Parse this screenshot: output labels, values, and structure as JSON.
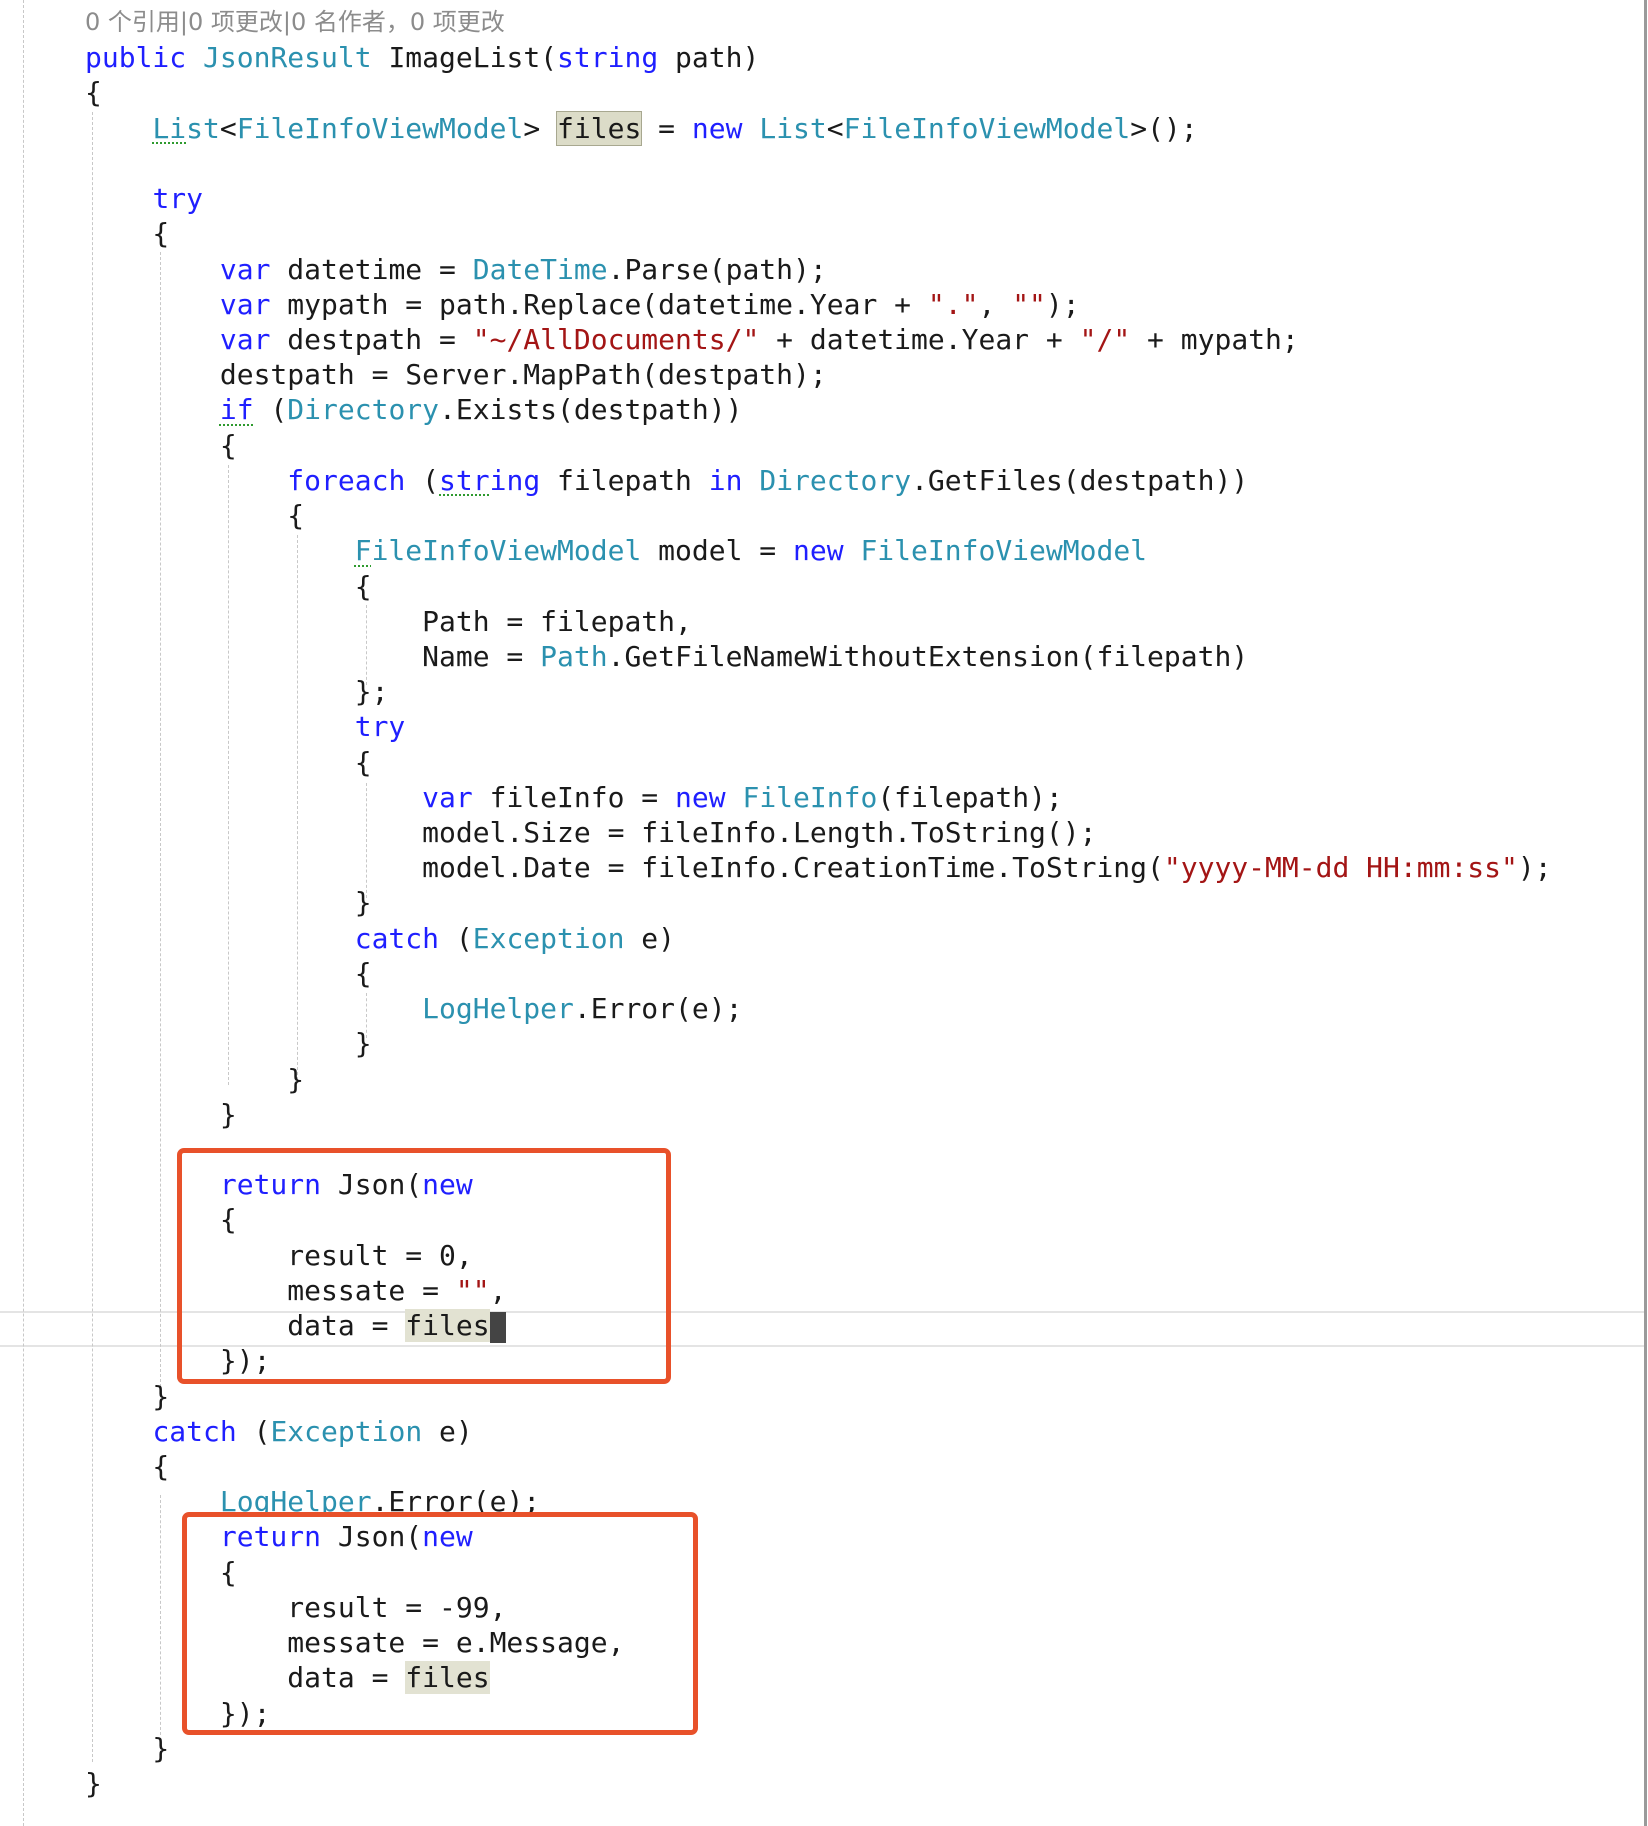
{
  "code_lens": "0 个引用|0 项更改|0 名作者，0 项更改",
  "colors": {
    "keyword": "#1f1fff",
    "type": "#2b91af",
    "string": "#a31515",
    "highlight_box": "#e8512a"
  },
  "lines": [
    [],
    [
      {
        "t": "public ",
        "c": "kw"
      },
      {
        "t": "JsonResult ",
        "c": "ty"
      },
      {
        "t": "ImageList(",
        "c": "pl"
      },
      {
        "t": "string",
        "c": "kw"
      },
      {
        "t": " path)",
        "c": "pl"
      }
    ],
    [
      {
        "t": "{",
        "c": "pl"
      }
    ],
    [
      {
        "t": "    ",
        "c": "pl"
      },
      {
        "t": "Li",
        "c": "ty sq"
      },
      {
        "t": "st",
        "c": "ty"
      },
      {
        "t": "<",
        "c": "pl"
      },
      {
        "t": "FileInfoViewModel",
        "c": "ty"
      },
      {
        "t": "> ",
        "c": "pl"
      },
      {
        "t": "files",
        "c": "pl hl"
      },
      {
        "t": " = ",
        "c": "pl"
      },
      {
        "t": "new ",
        "c": "kw"
      },
      {
        "t": "List",
        "c": "ty"
      },
      {
        "t": "<",
        "c": "pl"
      },
      {
        "t": "FileInfoViewModel",
        "c": "ty"
      },
      {
        "t": ">();",
        "c": "pl"
      }
    ],
    [],
    [
      {
        "t": "    ",
        "c": "pl"
      },
      {
        "t": "try",
        "c": "kw"
      }
    ],
    [
      {
        "t": "    {",
        "c": "pl"
      }
    ],
    [
      {
        "t": "        ",
        "c": "pl"
      },
      {
        "t": "var ",
        "c": "kw"
      },
      {
        "t": "datetime = ",
        "c": "pl"
      },
      {
        "t": "DateTime",
        "c": "ty"
      },
      {
        "t": ".Parse(path);",
        "c": "pl"
      }
    ],
    [
      {
        "t": "        ",
        "c": "pl"
      },
      {
        "t": "var ",
        "c": "kw"
      },
      {
        "t": "mypath = path.Replace(datetime.Year + ",
        "c": "pl"
      },
      {
        "t": "\".\"",
        "c": "st"
      },
      {
        "t": ", ",
        "c": "pl"
      },
      {
        "t": "\"\"",
        "c": "st"
      },
      {
        "t": ");",
        "c": "pl"
      }
    ],
    [
      {
        "t": "        ",
        "c": "pl"
      },
      {
        "t": "var ",
        "c": "kw"
      },
      {
        "t": "destpath = ",
        "c": "pl"
      },
      {
        "t": "\"~/AllDocuments/\"",
        "c": "st"
      },
      {
        "t": " + datetime.Year + ",
        "c": "pl"
      },
      {
        "t": "\"/\"",
        "c": "st"
      },
      {
        "t": " + mypath;",
        "c": "pl"
      }
    ],
    [
      {
        "t": "        destpath = Server.MapPath(destpath);",
        "c": "pl"
      }
    ],
    [
      {
        "t": "        ",
        "c": "pl"
      },
      {
        "t": "if",
        "c": "kw sq"
      },
      {
        "t": " (",
        "c": "pl"
      },
      {
        "t": "Directory",
        "c": "ty"
      },
      {
        "t": ".Exists(destpath))",
        "c": "pl"
      }
    ],
    [
      {
        "t": "        {",
        "c": "pl"
      }
    ],
    [
      {
        "t": "            ",
        "c": "pl"
      },
      {
        "t": "foreach",
        "c": "kw"
      },
      {
        "t": " (",
        "c": "pl"
      },
      {
        "t": "str",
        "c": "kw sq"
      },
      {
        "t": "ing",
        "c": "kw"
      },
      {
        "t": " filepath ",
        "c": "pl"
      },
      {
        "t": "in ",
        "c": "kw"
      },
      {
        "t": "Directory",
        "c": "ty"
      },
      {
        "t": ".GetFiles(destpath))",
        "c": "pl"
      }
    ],
    [
      {
        "t": "            {",
        "c": "pl"
      }
    ],
    [
      {
        "t": "                ",
        "c": "pl"
      },
      {
        "t": "F",
        "c": "ty sq"
      },
      {
        "t": "ileInfoViewModel",
        "c": "ty"
      },
      {
        "t": " model = ",
        "c": "pl"
      },
      {
        "t": "new ",
        "c": "kw"
      },
      {
        "t": "FileInfoViewModel",
        "c": "ty"
      }
    ],
    [
      {
        "t": "                {",
        "c": "pl"
      }
    ],
    [
      {
        "t": "                    Path = filepath,",
        "c": "pl"
      }
    ],
    [
      {
        "t": "                    Name = ",
        "c": "pl"
      },
      {
        "t": "Path",
        "c": "ty"
      },
      {
        "t": ".GetFileNameWithoutExtension(filepath)",
        "c": "pl"
      }
    ],
    [
      {
        "t": "                };",
        "c": "pl"
      }
    ],
    [
      {
        "t": "                ",
        "c": "pl"
      },
      {
        "t": "try",
        "c": "kw"
      }
    ],
    [
      {
        "t": "                {",
        "c": "pl"
      }
    ],
    [
      {
        "t": "                    ",
        "c": "pl"
      },
      {
        "t": "var ",
        "c": "kw"
      },
      {
        "t": "fileInfo = ",
        "c": "pl"
      },
      {
        "t": "new ",
        "c": "kw"
      },
      {
        "t": "FileInfo",
        "c": "ty"
      },
      {
        "t": "(filepath);",
        "c": "pl"
      }
    ],
    [
      {
        "t": "                    model.Size = fileInfo.Length.ToString();",
        "c": "pl"
      }
    ],
    [
      {
        "t": "                    model.Date = fileInfo.CreationTime.ToString(",
        "c": "pl"
      },
      {
        "t": "\"yyyy-MM-dd HH:mm:ss\"",
        "c": "st"
      },
      {
        "t": ");",
        "c": "pl"
      }
    ],
    [
      {
        "t": "                }",
        "c": "pl"
      }
    ],
    [
      {
        "t": "                ",
        "c": "pl"
      },
      {
        "t": "catch",
        "c": "kw"
      },
      {
        "t": " (",
        "c": "pl"
      },
      {
        "t": "Exception",
        "c": "ty"
      },
      {
        "t": " e)",
        "c": "pl"
      }
    ],
    [
      {
        "t": "                {",
        "c": "pl"
      }
    ],
    [
      {
        "t": "                    ",
        "c": "pl"
      },
      {
        "t": "LogHelper",
        "c": "ty"
      },
      {
        "t": ".Error(e);",
        "c": "pl"
      }
    ],
    [
      {
        "t": "                }",
        "c": "pl"
      }
    ],
    [
      {
        "t": "            }",
        "c": "pl"
      }
    ],
    [
      {
        "t": "        }",
        "c": "pl"
      }
    ],
    [],
    [
      {
        "t": "        ",
        "c": "pl"
      },
      {
        "t": "return",
        "c": "kw"
      },
      {
        "t": " Json(",
        "c": "pl"
      },
      {
        "t": "new",
        "c": "kw"
      }
    ],
    [
      {
        "t": "        {",
        "c": "pl"
      }
    ],
    [
      {
        "t": "            result = 0,",
        "c": "pl"
      }
    ],
    [
      {
        "t": "            messate = ",
        "c": "pl"
      },
      {
        "t": "\"\"",
        "c": "st"
      },
      {
        "t": ",",
        "c": "pl"
      }
    ],
    [
      {
        "t": "            data = ",
        "c": "pl"
      },
      {
        "t": "files",
        "c": "pl hl2"
      },
      {
        "t": "",
        "c": "cursor"
      }
    ],
    [
      {
        "t": "        });",
        "c": "pl"
      }
    ],
    [
      {
        "t": "    }",
        "c": "pl"
      }
    ],
    [
      {
        "t": "    ",
        "c": "pl"
      },
      {
        "t": "catch",
        "c": "kw"
      },
      {
        "t": " (",
        "c": "pl"
      },
      {
        "t": "Exception",
        "c": "ty"
      },
      {
        "t": " e)",
        "c": "pl"
      }
    ],
    [
      {
        "t": "    {",
        "c": "pl"
      }
    ],
    [
      {
        "t": "        ",
        "c": "pl"
      },
      {
        "t": "LogHelper",
        "c": "ty"
      },
      {
        "t": ".Error(e);",
        "c": "pl"
      }
    ],
    [
      {
        "t": "        ",
        "c": "pl"
      },
      {
        "t": "return",
        "c": "kw"
      },
      {
        "t": " Json(",
        "c": "pl"
      },
      {
        "t": "new",
        "c": "kw"
      }
    ],
    [
      {
        "t": "        {",
        "c": "pl"
      }
    ],
    [
      {
        "t": "            result = -99,",
        "c": "pl"
      }
    ],
    [
      {
        "t": "            messate = e.Message,",
        "c": "pl"
      }
    ],
    [
      {
        "t": "            data = ",
        "c": "pl"
      },
      {
        "t": "files",
        "c": "pl hl2"
      }
    ],
    [
      {
        "t": "        });",
        "c": "pl"
      }
    ],
    [
      {
        "t": "    }",
        "c": "pl"
      }
    ],
    [
      {
        "t": "}",
        "c": "pl"
      }
    ]
  ]
}
